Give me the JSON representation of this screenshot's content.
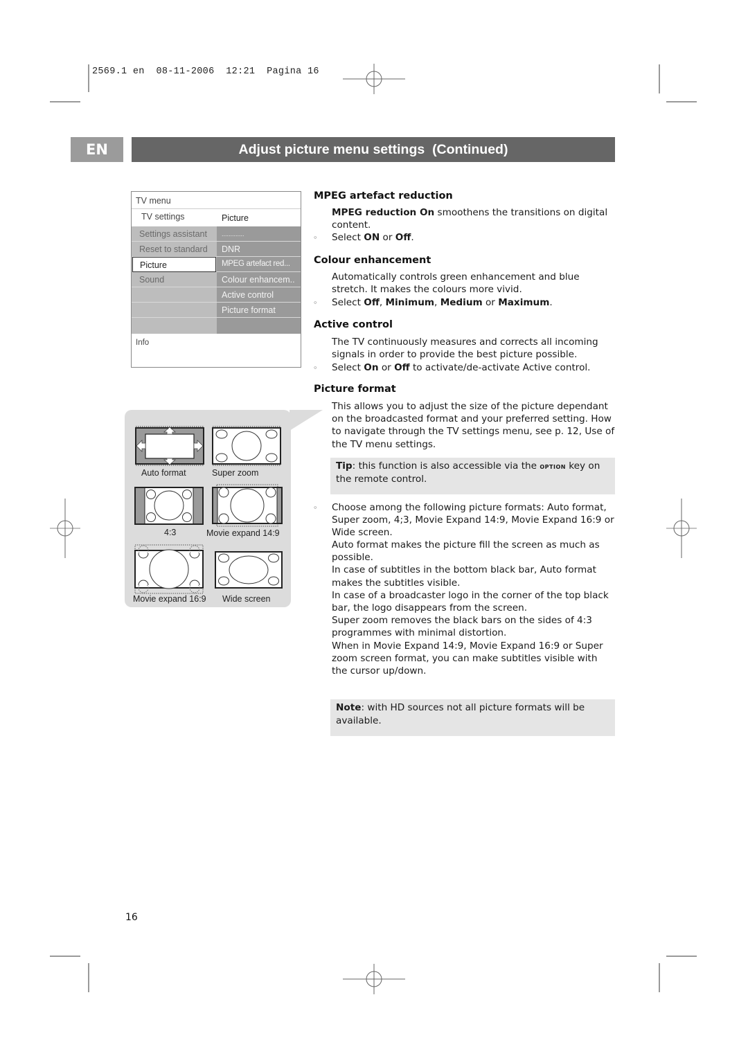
{
  "slug": {
    "job": "2569.1",
    "lang": "en",
    "date": "08-11-2006",
    "time": "12:21",
    "page_label": "Pagina",
    "page": "16"
  },
  "header": {
    "lang_tab": "EN",
    "title": "Adjust picture menu settings  (Continued)"
  },
  "tv_menu": {
    "title": "TV menu",
    "submenu_left": "TV settings",
    "submenu_right": "Picture",
    "left_items": [
      {
        "label": "Settings assistant",
        "selected": false
      },
      {
        "label": "Reset to standard",
        "selected": false
      },
      {
        "label": "Picture",
        "selected": true
      },
      {
        "label": "Sound",
        "selected": false
      }
    ],
    "right_items": [
      {
        "label": "............."
      },
      {
        "label": "DNR"
      },
      {
        "label": "MPEG artefact red..."
      },
      {
        "label": "Colour enhancem.."
      },
      {
        "label": "Active control"
      },
      {
        "label": "Picture format"
      }
    ],
    "info_label": "Info"
  },
  "formats": [
    {
      "label": "Auto format",
      "icon": "auto-format-icon"
    },
    {
      "label": "Super zoom",
      "icon": "super-zoom-icon"
    },
    {
      "label": "4:3",
      "icon": "format-4-3-icon"
    },
    {
      "label": "Movie expand 14:9",
      "icon": "movie-expand-14-9-icon"
    },
    {
      "label": "Movie expand 16:9",
      "icon": "movie-expand-16-9-icon"
    },
    {
      "label": "Wide screen",
      "icon": "wide-screen-icon"
    }
  ],
  "sections": {
    "mpeg": {
      "heading": "MPEG artefact reduction",
      "desc_bold": "MPEG reduction On",
      "desc_rest": " smoothens the transitions on digital content.",
      "bullet_pre": "Select ",
      "bullet_b1": "ON",
      "bullet_mid": " or ",
      "bullet_b2": "Off",
      "bullet_end": "."
    },
    "colour": {
      "heading": "Colour enhancement",
      "desc": "Automatically controls green enhancement and blue stretch. It makes the colours more vivid.",
      "bullet_pre": "Select ",
      "b1": "Off",
      "sep1": ", ",
      "b2": "Minimum",
      "sep2": ", ",
      "b3": "Medium",
      "sep3": " or ",
      "b4": "Maximum",
      "end": "."
    },
    "active": {
      "heading": "Active control",
      "desc": "The TV continuously measures and corrects all incoming signals in order to provide the best picture possible.",
      "bullet_pre": "Select ",
      "b1": "On",
      "mid": " or ",
      "b2": "Off",
      "end": " to activate/de-activate Active control."
    },
    "format": {
      "heading": "Picture format",
      "desc": "This allows you to adjust the size of the picture dependant on the broadcasted format and your preferred setting. How to navigate through the TV settings menu, see p. 12, Use of the TV menu settings.",
      "tip_bold": "Tip",
      "tip_pre": ": this function is also accessible via the ",
      "tip_key": "option",
      "tip_post": " key on the remote control.",
      "choose": "Choose among the following picture formats: Auto format, Super zoom, 4;3, Movie Expand 14:9, Movie Expand 16:9 or Wide screen.",
      "details": [
        "Auto format makes the picture fill the screen as much as possible.",
        "In case of subtitles in the bottom black bar, Auto format makes the subtitles visible.",
        "In case of a broadcaster logo in the  corner of the top black bar, the logo disappears from the screen.",
        "Super zoom removes the black bars on the sides of 4:3 programmes with minimal distortion.",
        "When in Movie Expand 14:9, Movie Expand 16:9 or Super zoom screen format, you can make subtitles visible with the cursor up/down."
      ],
      "note_bold": "Note",
      "note_rest": ": with HD sources not all picture formats will be available."
    }
  },
  "page_number": "16"
}
